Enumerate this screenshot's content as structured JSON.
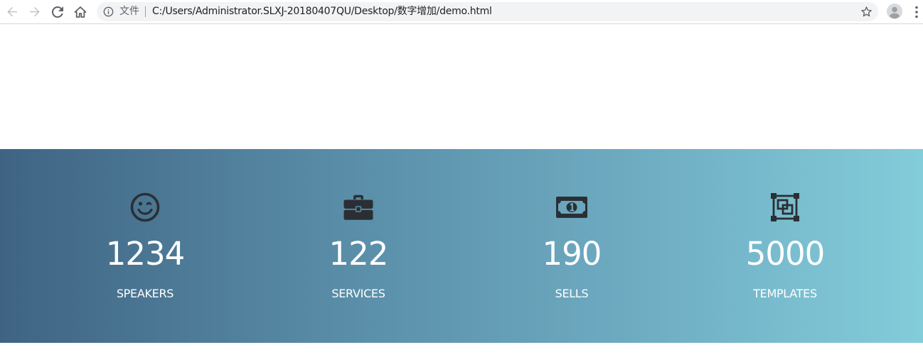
{
  "browser": {
    "omnibox_label": "文件",
    "url": "C:/Users/Administrator.SLXJ-20180407QU/Desktop/数字增加/demo.html",
    "icons": [
      "back-arrow-icon",
      "forward-arrow-icon",
      "reload-icon",
      "home-icon",
      "info-icon",
      "star-icon",
      "account-avatar-icon",
      "more-menu-icon"
    ]
  },
  "stats": [
    {
      "icon": "smile-icon",
      "value": "1234",
      "label": "SPEAKERS"
    },
    {
      "icon": "briefcase-icon",
      "value": "122",
      "label": "SERVICES"
    },
    {
      "icon": "money-icon",
      "value": "190",
      "label": "SELLS"
    },
    {
      "icon": "template-icon",
      "value": "5000",
      "label": "TEMPLATES"
    }
  ],
  "colors": {
    "gradient_start": "#3f6483",
    "gradient_end": "#83ccda",
    "icon_color": "#2b2f33",
    "text_color": "#ffffff"
  }
}
